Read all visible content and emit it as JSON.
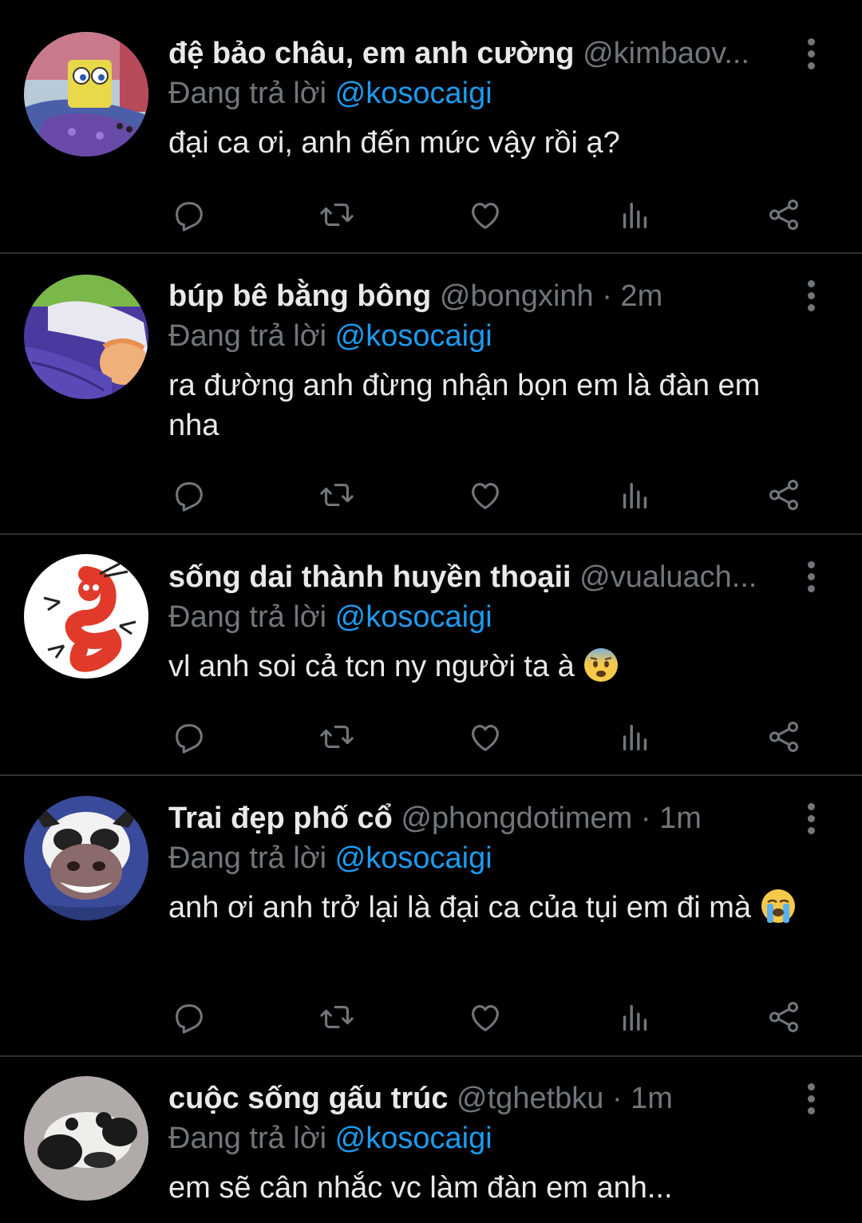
{
  "replying_label": "Đang trả lời",
  "tweets": [
    {
      "display_name": "đệ bảo châu, em anh cường",
      "handle": "@kimbaov...",
      "mention": "@kosocaigi",
      "text": "đại ca ơi, anh đến mức vậy rồi ạ?",
      "avatar": "spongebob-avatar"
    },
    {
      "display_name": "búp bê bằng bông",
      "handle": "@bongxinh · 2m",
      "mention": "@kosocaigi",
      "text": "ra đường anh đừng nhận bọn em là đàn em nha",
      "avatar": "sleeping-cartoon-avatar"
    },
    {
      "display_name": "sống dai thành huyền thoạii",
      "handle": "@vualuach...",
      "mention": "@kosocaigi",
      "text": "vl anh soi cả tcn ny người ta à",
      "emoji": "anxious-face-emoji",
      "avatar": "red-dragon-avatar"
    },
    {
      "display_name": "Trai đẹp phố cổ",
      "handle": "@phongdotimem · 1m",
      "mention": "@kosocaigi",
      "text": "anh ơi anh trở lại là đại ca của tụi em đi mà",
      "emoji": "loudly-crying-face-emoji",
      "avatar": "smiling-cow-avatar"
    },
    {
      "display_name": "cuộc sống gấu trúc",
      "handle": "@tghetbku · 1m",
      "mention": "@kosocaigi",
      "text": "em sẽ cân nhắc vc làm đàn em anh...",
      "avatar": "panda-avatar"
    }
  ],
  "colors": {
    "background": "#000000",
    "text": "#e7e9ea",
    "muted": "#71767b",
    "accent": "#1d9bf0",
    "divider": "#2f3336"
  },
  "icons": [
    "reply-icon",
    "retweet-icon",
    "like-icon",
    "views-icon",
    "share-icon",
    "more-options-icon"
  ]
}
